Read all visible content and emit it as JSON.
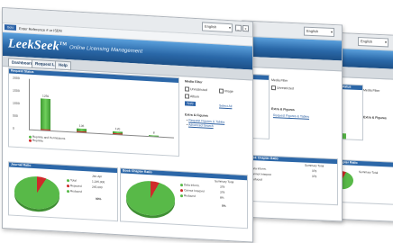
{
  "colors": {
    "accent": "#2c67a8",
    "approved": "#58b948",
    "rejected": "#cf2a2a",
    "banner_dark": "#1c4f86"
  },
  "window": {
    "language_select": "English",
    "close_glyph": "x",
    "min_glyph": "_",
    "max_glyph": "□"
  },
  "address": {
    "button": "Goto",
    "text": "Enter Reference # or ISBN"
  },
  "banner": {
    "logo": "LeekSeek",
    "logo_sup": "TM",
    "tagline": "Online Licensing Management"
  },
  "tabs": [
    "Dashboard",
    "Request List",
    "Help"
  ],
  "chart_panel": {
    "title": "Request Status"
  },
  "chart_data": {
    "type": "bar",
    "categories": [
      "",
      "",
      "",
      ""
    ],
    "series": [
      {
        "name": "Reprints and Permissions",
        "values": [
          1250,
          135,
          120,
          8
        ]
      },
      {
        "name": "Reprints",
        "values": [
          40,
          10,
          5,
          0
        ]
      }
    ],
    "data_labels": [
      "1250",
      "135",
      "120",
      "8"
    ],
    "ylim": [
      0,
      2000
    ],
    "yticks": [
      "2000",
      "1500",
      "1000",
      "500",
      "0"
    ],
    "legend": "bottom-left"
  },
  "filter": {
    "title": "Media Filter",
    "options": [
      "Unrestricted",
      "Image",
      "Album"
    ],
    "apply": "Apply",
    "select_all": "Select All",
    "figures_title": "Extra & Figures",
    "links": [
      "Request Figures & Tables",
      "Advanced Search"
    ]
  },
  "pie_left": {
    "title": "Journal Ratio",
    "header": "Jan-Apr",
    "rows": [
      {
        "label": "Total",
        "value": "1,245,000"
      },
      {
        "label": "Rejected",
        "value": "245,000"
      },
      {
        "label": "Reduced",
        "value": "93%"
      }
    ]
  },
  "pie_right": {
    "title": "Book Chapter Ratio",
    "header": "Summary Total",
    "rows": [
      {
        "label": "Data Inform.",
        "value": "379"
      },
      {
        "label": "Cannot Interpret",
        "value": "379"
      },
      {
        "label": "Reduced",
        "value": "8%"
      }
    ],
    "total": "5%"
  }
}
